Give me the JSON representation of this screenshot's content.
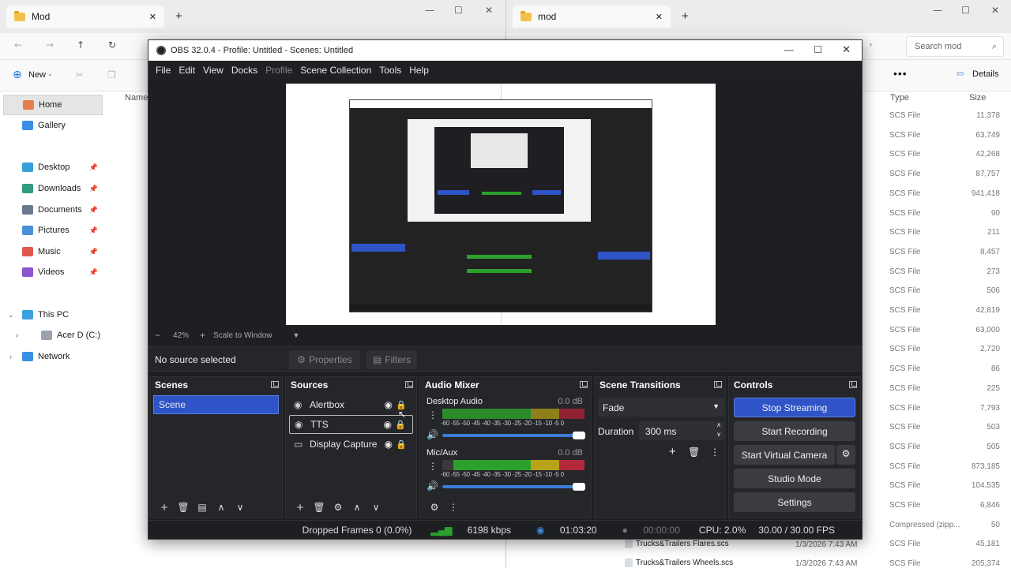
{
  "explorer_left": {
    "tab_title": "Mod",
    "new_label": "New",
    "column_name": "Name",
    "sidebar": [
      {
        "label": "Home",
        "icon": "home-icon",
        "pinned": false
      },
      {
        "label": "Gallery",
        "icon": "gallery-icon",
        "pinned": false
      },
      {
        "label": "Desktop",
        "icon": "desktop-icon",
        "pinned": true
      },
      {
        "label": "Downloads",
        "icon": "downloads-icon",
        "pinned": true
      },
      {
        "label": "Documents",
        "icon": "documents-icon",
        "pinned": true
      },
      {
        "label": "Pictures",
        "icon": "pictures-icon",
        "pinned": true
      },
      {
        "label": "Music",
        "icon": "music-icon",
        "pinned": true
      },
      {
        "label": "Videos",
        "icon": "videos-icon",
        "pinned": true
      },
      {
        "label": "This PC",
        "icon": "pc-icon",
        "pinned": false
      },
      {
        "label": "Acer D (C:)",
        "icon": "drive-icon",
        "pinned": false
      },
      {
        "label": "Network",
        "icon": "network-icon",
        "pinned": false
      }
    ]
  },
  "explorer_right": {
    "tab_title": "mod",
    "search_placeholder": "Search mod",
    "details_label": "Details",
    "col_type": "Type",
    "col_size": "Size",
    "rows": [
      {
        "type": "SCS File",
        "size": "11,378"
      },
      {
        "type": "SCS File",
        "size": "63,749"
      },
      {
        "type": "SCS File",
        "size": "42,268"
      },
      {
        "type": "SCS File",
        "size": "87,757"
      },
      {
        "type": "SCS File",
        "size": "941,418"
      },
      {
        "type": "SCS File",
        "size": "90"
      },
      {
        "type": "SCS File",
        "size": "211"
      },
      {
        "type": "SCS File",
        "size": "8,457"
      },
      {
        "type": "SCS File",
        "size": "273"
      },
      {
        "type": "SCS File",
        "size": "506"
      },
      {
        "type": "SCS File",
        "size": "42,819"
      },
      {
        "type": "SCS File",
        "size": "63,000"
      },
      {
        "type": "SCS File",
        "size": "2,720"
      },
      {
        "type": "SCS File",
        "size": "86"
      },
      {
        "type": "SCS File",
        "size": "225"
      },
      {
        "type": "SCS File",
        "size": "7,793"
      },
      {
        "type": "SCS File",
        "size": "503"
      },
      {
        "type": "SCS File",
        "size": "505"
      },
      {
        "type": "SCS File",
        "size": "873,185"
      },
      {
        "type": "SCS File",
        "size": "104,535"
      },
      {
        "type": "SCS File",
        "size": "6,846"
      },
      {
        "type": "Compressed (zipp...",
        "size": "50"
      },
      {
        "type": "SCS File",
        "size": "45,181"
      },
      {
        "type": "SCS File",
        "size": "205,374"
      }
    ],
    "bottom_files": [
      {
        "name": "Trucks&Trailers Flares.scs",
        "date": "1/3/2026 7:43 AM"
      },
      {
        "name": "Trucks&Trailers Wheels.scs",
        "date": "1/3/2026 7:43 AM"
      }
    ]
  },
  "obs": {
    "title": "OBS 32.0.4 - Profile: Untitled - Scenes: Untitled",
    "menu": [
      "File",
      "Edit",
      "View",
      "Docks",
      "Profile",
      "Scene Collection",
      "Tools",
      "Help"
    ],
    "zoom": "42%",
    "scale_mode": "Scale to Window",
    "no_source": "No source selected",
    "properties_label": "Properties",
    "filters_label": "Filters",
    "panels": {
      "scenes": "Scenes",
      "sources": "Sources",
      "audio_mixer": "Audio Mixer",
      "scene_transitions": "Scene Transitions",
      "controls": "Controls"
    },
    "scenes": [
      "Scene"
    ],
    "sources": [
      {
        "name": "Alertbox",
        "icon": "browser-source-icon"
      },
      {
        "name": "TTS",
        "icon": "browser-source-icon"
      },
      {
        "name": "Display Capture",
        "icon": "monitor-icon"
      }
    ],
    "audio": [
      {
        "name": "Desktop Audio",
        "db": "0.0 dB",
        "volume": 1.0
      },
      {
        "name": "Mic/Aux",
        "db": "0.0 dB",
        "volume": 1.0
      }
    ],
    "meter_ticks": "-60 -55 -50 -45 -40 -35 -30 -25 -20 -15 -10 -5 0",
    "transition": "Fade",
    "duration_label": "Duration",
    "duration_value": "300 ms",
    "controls": [
      "Stop Streaming",
      "Start Recording",
      "Start Virtual Camera",
      "Studio Mode",
      "Settings"
    ],
    "status": {
      "dropped": "Dropped Frames 0 (0.0%)",
      "kbps": "6198 kbps",
      "stream_time": "01:03:20",
      "rec_time": "00:00:00",
      "cpu": "CPU: 2.0%",
      "fps": "30.00 / 30.00 FPS"
    },
    "colors": {
      "accent": "#2f54c8",
      "meter_green": "#2ca02c",
      "meter_yellow": "#b8a21a",
      "meter_red": "#b3283a"
    }
  }
}
